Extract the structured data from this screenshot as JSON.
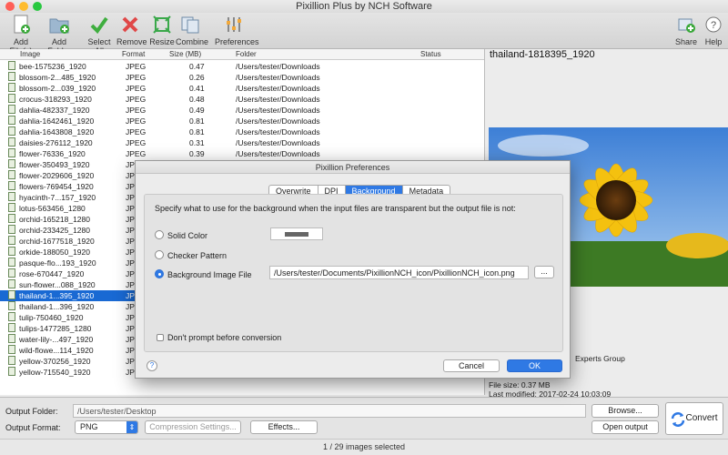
{
  "window": {
    "title": "Pixillion Plus by NCH Software"
  },
  "toolbar": {
    "add_files": "Add File(s)",
    "add_folder": "Add Folder",
    "select_all": "Select All",
    "remove": "Remove",
    "resize": "Resize",
    "combine": "Combine",
    "preferences": "Preferences",
    "share": "Share",
    "help": "Help"
  },
  "list": {
    "headers": {
      "image": "Image",
      "format": "Format",
      "size": "Size (MB)",
      "folder": "Folder",
      "status": "Status"
    },
    "rows": [
      {
        "name": "bee-1575236_1920",
        "format": "JPEG",
        "size": "0.47",
        "folder": "/Users/tester/Downloads"
      },
      {
        "name": "blossom-2...485_1920",
        "format": "JPEG",
        "size": "0.26",
        "folder": "/Users/tester/Downloads"
      },
      {
        "name": "blossom-2...039_1920",
        "format": "JPEG",
        "size": "0.41",
        "folder": "/Users/tester/Downloads"
      },
      {
        "name": "crocus-318293_1920",
        "format": "JPEG",
        "size": "0.48",
        "folder": "/Users/tester/Downloads"
      },
      {
        "name": "dahlia-482337_1920",
        "format": "JPEG",
        "size": "0.49",
        "folder": "/Users/tester/Downloads"
      },
      {
        "name": "dahlia-1642461_1920",
        "format": "JPEG",
        "size": "0.81",
        "folder": "/Users/tester/Downloads"
      },
      {
        "name": "dahlia-1643808_1920",
        "format": "JPEG",
        "size": "0.81",
        "folder": "/Users/tester/Downloads"
      },
      {
        "name": "daisies-276112_1920",
        "format": "JPEG",
        "size": "0.31",
        "folder": "/Users/tester/Downloads"
      },
      {
        "name": "flower-76336_1920",
        "format": "JPEG",
        "size": "0.39",
        "folder": "/Users/tester/Downloads"
      },
      {
        "name": "flower-350493_1920",
        "format": "JPEG",
        "size": "",
        "folder": ""
      },
      {
        "name": "flower-2029606_1920",
        "format": "JPEG",
        "size": "",
        "folder": ""
      },
      {
        "name": "flowers-769454_1920",
        "format": "JPEG",
        "size": "",
        "folder": ""
      },
      {
        "name": "hyacinth-7...157_1920",
        "format": "JPEG",
        "size": "",
        "folder": ""
      },
      {
        "name": "lotus-563456_1280",
        "format": "JPEG",
        "size": "",
        "folder": ""
      },
      {
        "name": "orchid-165218_1280",
        "format": "JPEG",
        "size": "",
        "folder": ""
      },
      {
        "name": "orchid-233425_1280",
        "format": "JPEG",
        "size": "",
        "folder": ""
      },
      {
        "name": "orchid-1677518_1920",
        "format": "JPEG",
        "size": "",
        "folder": ""
      },
      {
        "name": "orkide-188050_1920",
        "format": "JPEG",
        "size": "",
        "folder": ""
      },
      {
        "name": "pasque-flo...193_1920",
        "format": "JPEG",
        "size": "",
        "folder": ""
      },
      {
        "name": "rose-670447_1920",
        "format": "JPEG",
        "size": "",
        "folder": ""
      },
      {
        "name": "sun-flower...088_1920",
        "format": "JPEG",
        "size": "",
        "folder": ""
      },
      {
        "name": "thailand-1...395_1920",
        "format": "JPEG",
        "size": "",
        "folder": ""
      },
      {
        "name": "thailand-1...396_1920",
        "format": "JPEG",
        "size": "",
        "folder": ""
      },
      {
        "name": "tulip-750460_1920",
        "format": "JPEG",
        "size": "",
        "folder": ""
      },
      {
        "name": "tulips-1477285_1280",
        "format": "JPEG",
        "size": "",
        "folder": ""
      },
      {
        "name": "water-lily-...497_1920",
        "format": "JPEG",
        "size": "",
        "folder": ""
      },
      {
        "name": "wild-flowe...114_1920",
        "format": "JPEG",
        "size": "",
        "folder": ""
      },
      {
        "name": "yellow-370256_1920",
        "format": "JPEG",
        "size": "",
        "folder": ""
      },
      {
        "name": "yellow-715540_1920",
        "format": "JPEG",
        "size": "",
        "folder": ""
      }
    ]
  },
  "preview": {
    "title": "thailand-1818395_1920",
    "group": "Experts Group",
    "file_size": "File size: 0.37 MB",
    "last_modified": "Last modified: 2017-02-24 10:03:09"
  },
  "bottom": {
    "output_folder_label": "Output Folder:",
    "output_folder_value": "/Users/tester/Desktop",
    "browse": "Browse...",
    "output_format_label": "Output Format:",
    "output_format_value": "PNG",
    "compression": "Compression Settings...",
    "effects": "Effects...",
    "open_output": "Open output",
    "convert": "Convert"
  },
  "status_text": "1 / 29 images selected",
  "dialog": {
    "title": "Pixillion Preferences",
    "tabs": [
      "Overwrite",
      "DPI",
      "Background",
      "Metadata"
    ],
    "description": "Specify what to use for the background when the input files are transparent but the output file is not:",
    "solid_color": "Solid Color",
    "checker": "Checker Pattern",
    "bg_image": "Background Image File",
    "bg_path": "/Users/tester/Documents/PixillionNCH_icon/PixillionNCH_icon.png",
    "browse": "...",
    "dont_prompt": "Don't prompt before conversion",
    "help": "?",
    "cancel": "Cancel",
    "ok": "OK"
  }
}
